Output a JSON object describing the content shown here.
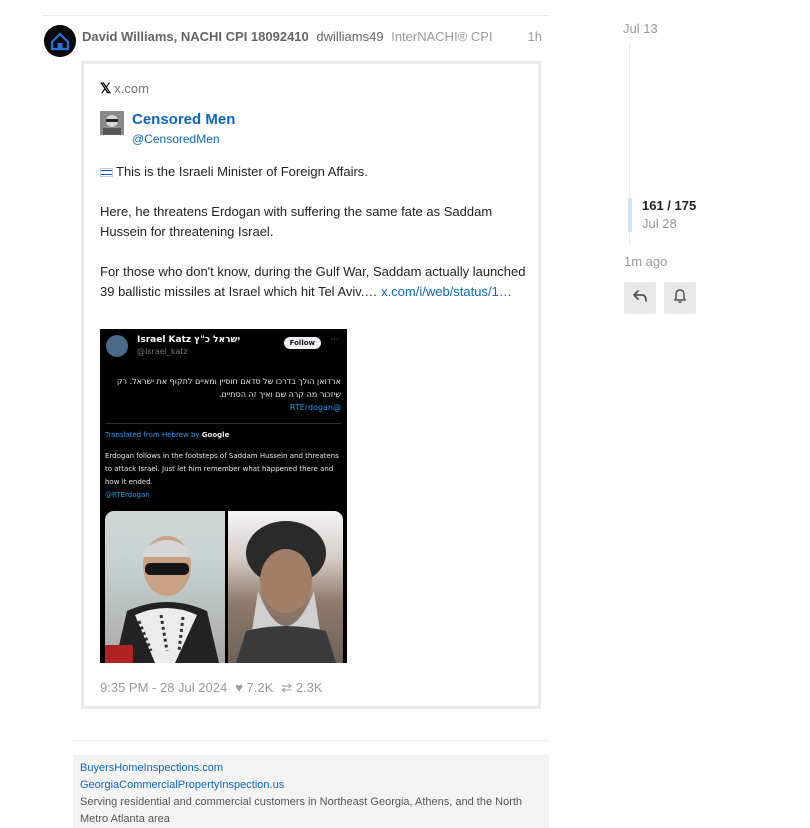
{
  "post": {
    "author_name": "David Williams, NACHI CPI 18092410",
    "author_username": "dwilliams49",
    "author_title": "InterNACHI® CPI",
    "age": "1h"
  },
  "onebox": {
    "source": "x.com",
    "profile_name": "Censored Men",
    "profile_handle": "@CensoredMen",
    "paragraph_1": "This is the Israeli Minister of Foreign Affairs.",
    "paragraph_2": "Here, he threatens Erdogan with suffering the same fate as Saddam Hussein for threatening Israel.",
    "paragraph_3": "For those who don't know, during the Gulf War, Saddam actually launched 39 ballistic missiles at Israel which hit Tel Aviv.… ",
    "link_text": "x.com/i/web/status/1…",
    "timestamp": "9:35 PM - 28 Jul 2024",
    "likes": "7.2K",
    "retweets": "2.3K",
    "embedded_tweet": {
      "name": "Israel Katz ישראל כ\"ץ",
      "handle": "@Israel_katz",
      "follow_label": "Follow",
      "more_label": "···",
      "hebrew_text": "ארדואן הולך בדרכו של סדאם חוסיין ומאיים לתקוף את ישראל. רק שיזכור מה קרה שם ואיך זה הסתיים.",
      "hebrew_tag": "@RTErdogan",
      "translated_prefix": "Translated from Hebrew by",
      "translated_brand": "Google",
      "english_text": "Erdogan follows in the footsteps of Saddam Hussein and threatens to attack Israel. Just let him remember what happened there and how it ended.",
      "english_tag": "@RTErdogan"
    }
  },
  "signature": {
    "link_1": "BuyersHomeInspections.com",
    "link_2": "GeorgiaCommercialPropertyInspection.us",
    "text": "Serving residential and commercial customers in Northeast Georgia, Athens, and the North Metro Atlanta area"
  },
  "timeline": {
    "start_date": "Jul 13",
    "position": "161 / 175",
    "current_date": "Jul 28",
    "last_activity": "1m ago"
  },
  "icons": {
    "x_logo": "𝕏",
    "heart": "♥",
    "retweet": "⇄",
    "reply": "reply-icon",
    "bell": "bell-icon"
  }
}
